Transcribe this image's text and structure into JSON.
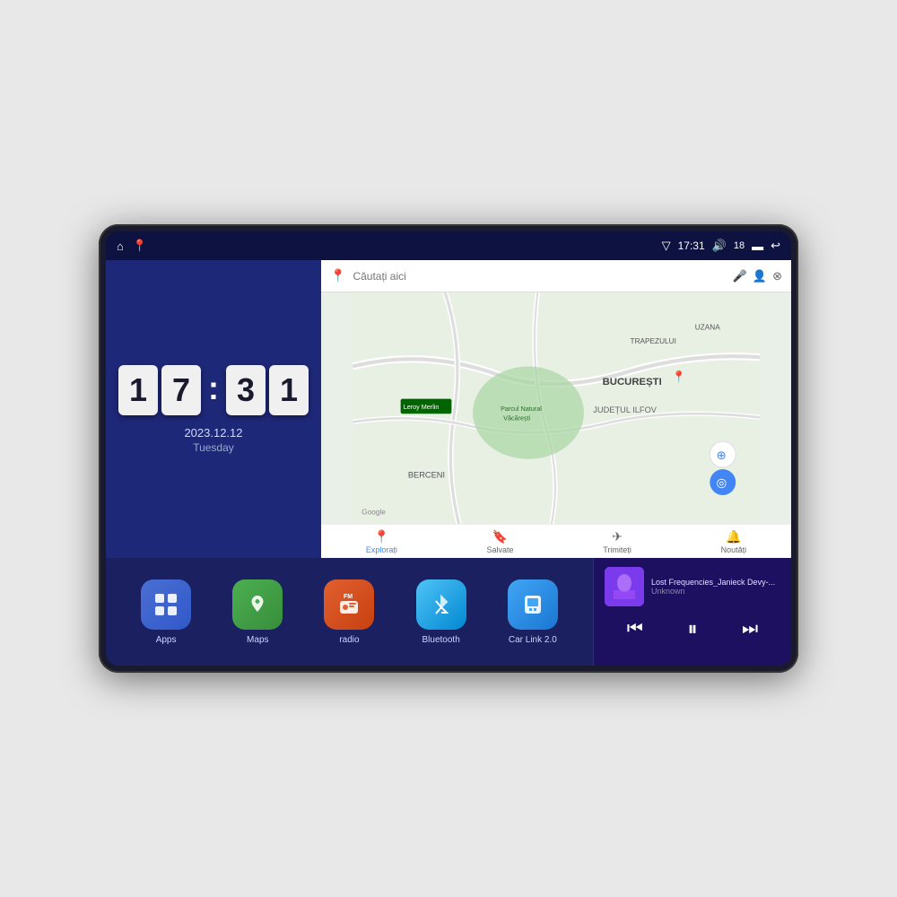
{
  "device": {
    "status_bar": {
      "left_icons": [
        "home",
        "maps-pin"
      ],
      "signal_icon": "▽",
      "time": "17:31",
      "volume_icon": "🔊",
      "battery_number": "18",
      "battery_icon": "🔋",
      "back_icon": "↩"
    },
    "clock": {
      "hour_tens": "1",
      "hour_ones": "7",
      "min_tens": "3",
      "min_ones": "1",
      "date": "2023.12.12",
      "day": "Tuesday"
    },
    "map": {
      "search_placeholder": "Căutați aici",
      "nav_items": [
        {
          "label": "Explorați",
          "icon": "📍",
          "active": true
        },
        {
          "label": "Salvate",
          "icon": "🔖",
          "active": false
        },
        {
          "label": "Trimiteți",
          "icon": "✈",
          "active": false
        },
        {
          "label": "Noutăți",
          "icon": "🔔",
          "active": false
        }
      ],
      "locations": [
        "Parcul Natural Văcărești",
        "Leroy Merlin",
        "BUCUREȘTI",
        "JUDEȚUL ILFOV",
        "BERCENI",
        "TRAPEZULUI",
        "UZANA"
      ]
    },
    "apps": [
      {
        "id": "apps",
        "label": "Apps",
        "icon": "⊞",
        "class": "app-apps"
      },
      {
        "id": "maps",
        "label": "Maps",
        "icon": "📍",
        "class": "app-maps"
      },
      {
        "id": "radio",
        "label": "radio",
        "icon": "📻",
        "class": "app-radio"
      },
      {
        "id": "bluetooth",
        "label": "Bluetooth",
        "icon": "❋",
        "class": "app-bluetooth"
      },
      {
        "id": "carlink",
        "label": "Car Link 2.0",
        "icon": "📱",
        "class": "app-carlink"
      }
    ],
    "music": {
      "title": "Lost Frequencies_Janieck Devy-...",
      "artist": "Unknown",
      "prev_btn": "⏮",
      "play_btn": "⏸",
      "next_btn": "⏭",
      "thumb_emoji": "🎵"
    }
  }
}
